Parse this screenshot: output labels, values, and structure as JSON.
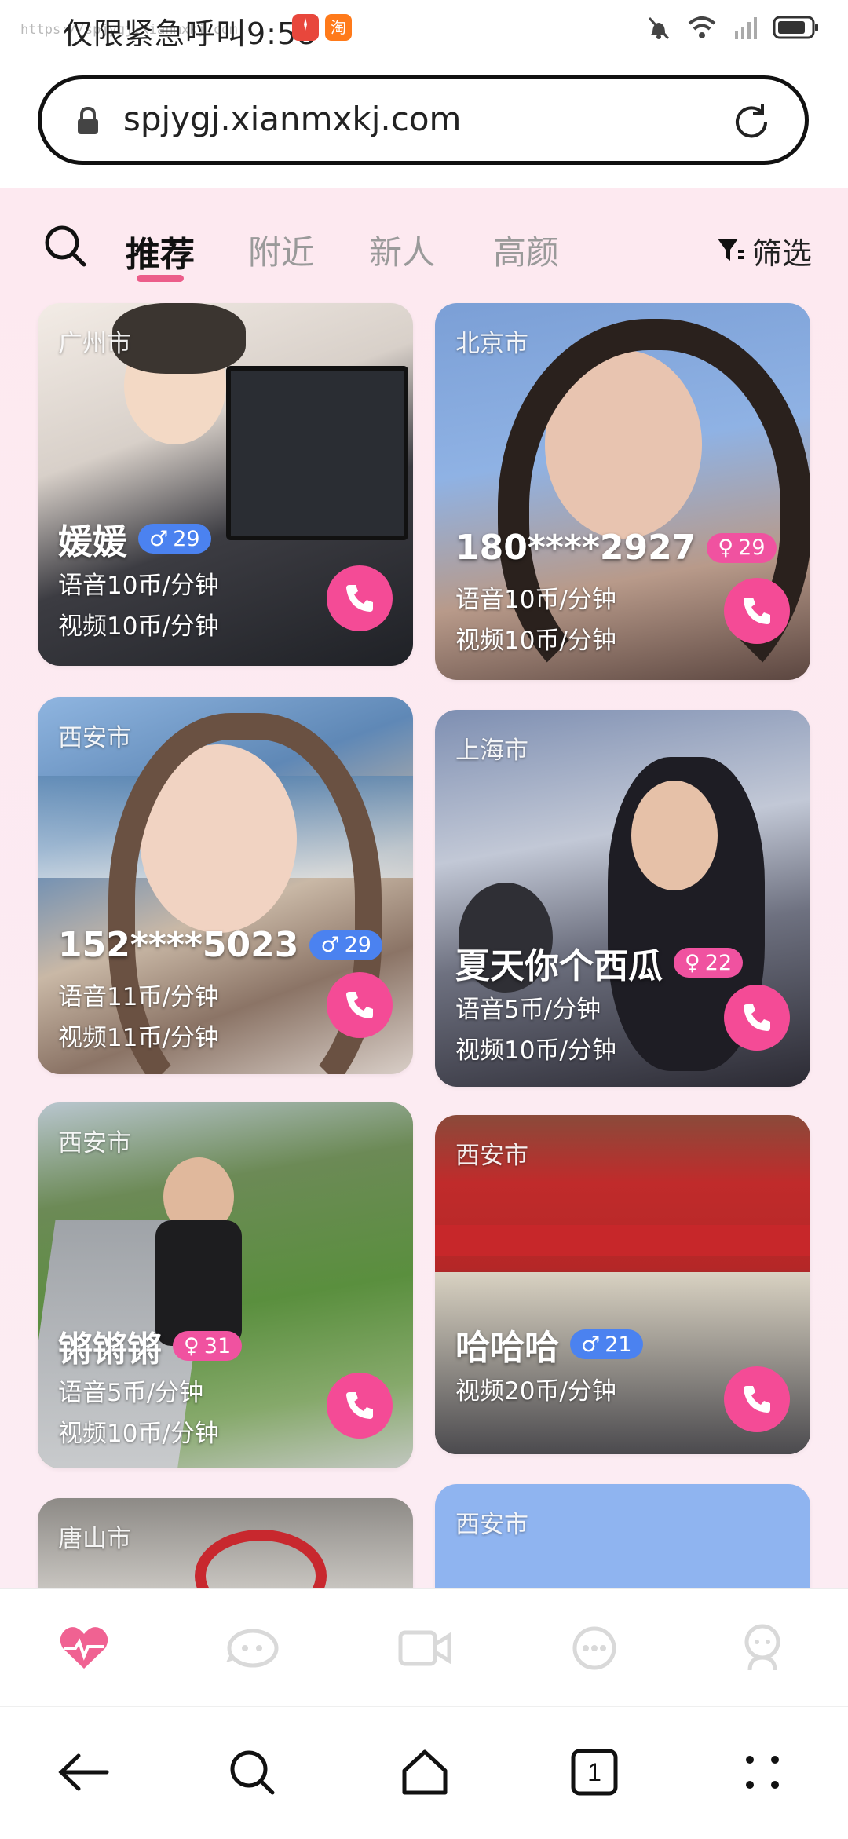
{
  "status_bar": {
    "url_overlay": "https://spjygj.xianmxkj.com",
    "text": "仅限紧急呼叫9:58",
    "app_icons": [
      "huawei-app-icon",
      "taobao-icon"
    ],
    "taobao_glyph": "淘",
    "right_icons": [
      "mute-icon",
      "wifi-icon",
      "no-signal-icon",
      "battery-icon"
    ]
  },
  "url_bar": {
    "url": "spjygj.xianmxkj.com",
    "lock_icon": "lock-icon",
    "reload_icon": "reload-icon"
  },
  "tabs": {
    "items": [
      {
        "label": "推荐",
        "active": true
      },
      {
        "label": "附近",
        "active": false
      },
      {
        "label": "新人",
        "active": false
      },
      {
        "label": "高颜",
        "active": false
      }
    ],
    "filter_label": "筛选",
    "search_icon": "search-icon",
    "filter_icon": "filter-icon",
    "accent": "#ec5d8a"
  },
  "cards": [
    {
      "city": "广州市",
      "name": "媛媛",
      "gender": "male",
      "gender_symbol": "♂",
      "age": "29",
      "voice": "语音10币/分钟",
      "video": "视频10币/分钟"
    },
    {
      "city": "北京市",
      "name": "180****2927",
      "gender": "female",
      "gender_symbol": "♀",
      "age": "29",
      "voice": "语音10币/分钟",
      "video": "视频10币/分钟"
    },
    {
      "city": "西安市",
      "name": "152****5023",
      "gender": "male",
      "gender_symbol": "♂",
      "age": "29",
      "voice": "语音11币/分钟",
      "video": "视频11币/分钟"
    },
    {
      "city": "上海市",
      "name": "夏天你个西瓜",
      "gender": "female",
      "gender_symbol": "♀",
      "age": "22",
      "voice": "语音5币/分钟",
      "video": "视频10币/分钟"
    },
    {
      "city": "西安市",
      "name": "锵锵锵",
      "gender": "female",
      "gender_symbol": "♀",
      "age": "31",
      "voice": "语音5币/分钟",
      "video": "视频10币/分钟"
    },
    {
      "city": "西安市",
      "name": "哈哈哈",
      "gender": "male",
      "gender_symbol": "♂",
      "age": "21",
      "voice": "",
      "video": "视频20币/分钟"
    },
    {
      "city": "唐山市"
    },
    {
      "city": "西安市"
    }
  ],
  "app_nav": {
    "items": [
      "heart-pulse-icon",
      "chat-bubble-icon",
      "video-icon",
      "message-icon",
      "profile-icon"
    ],
    "active_color": "#f06292",
    "inactive_color": "#d9d9d9"
  },
  "browser_nav": {
    "items": [
      "back-arrow-icon",
      "search-icon",
      "home-icon",
      "tabs-icon",
      "menu-icon"
    ],
    "tab_count": "1"
  }
}
